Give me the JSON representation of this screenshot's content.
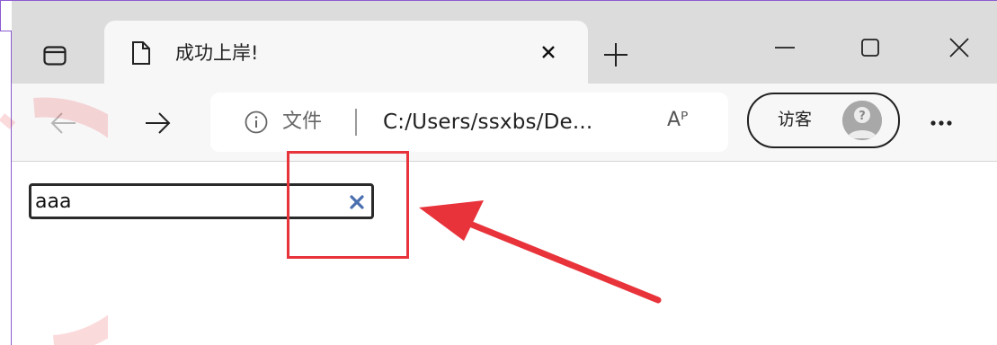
{
  "tab": {
    "title": "成功上岸!"
  },
  "address_bar": {
    "security_label": "文件",
    "url": "C:/Users/ssxbs/De...",
    "read_aloud": "Aᴾ"
  },
  "profile": {
    "label": "访客"
  },
  "search_input": {
    "value": "aaa"
  },
  "icons": [
    "tab-actions-icon",
    "page-icon",
    "close-tab-icon",
    "new-tab-icon",
    "minimize-icon",
    "maximize-icon",
    "close-window-icon",
    "back-arrow-icon",
    "forward-arrow-icon",
    "info-icon",
    "read-aloud-icon",
    "avatar-icon",
    "more-icon",
    "clear-icon"
  ],
  "colors": {
    "annotation": "#e8333b",
    "clear_icon": "#4a6fb0",
    "frame": "#8a5cd0"
  }
}
